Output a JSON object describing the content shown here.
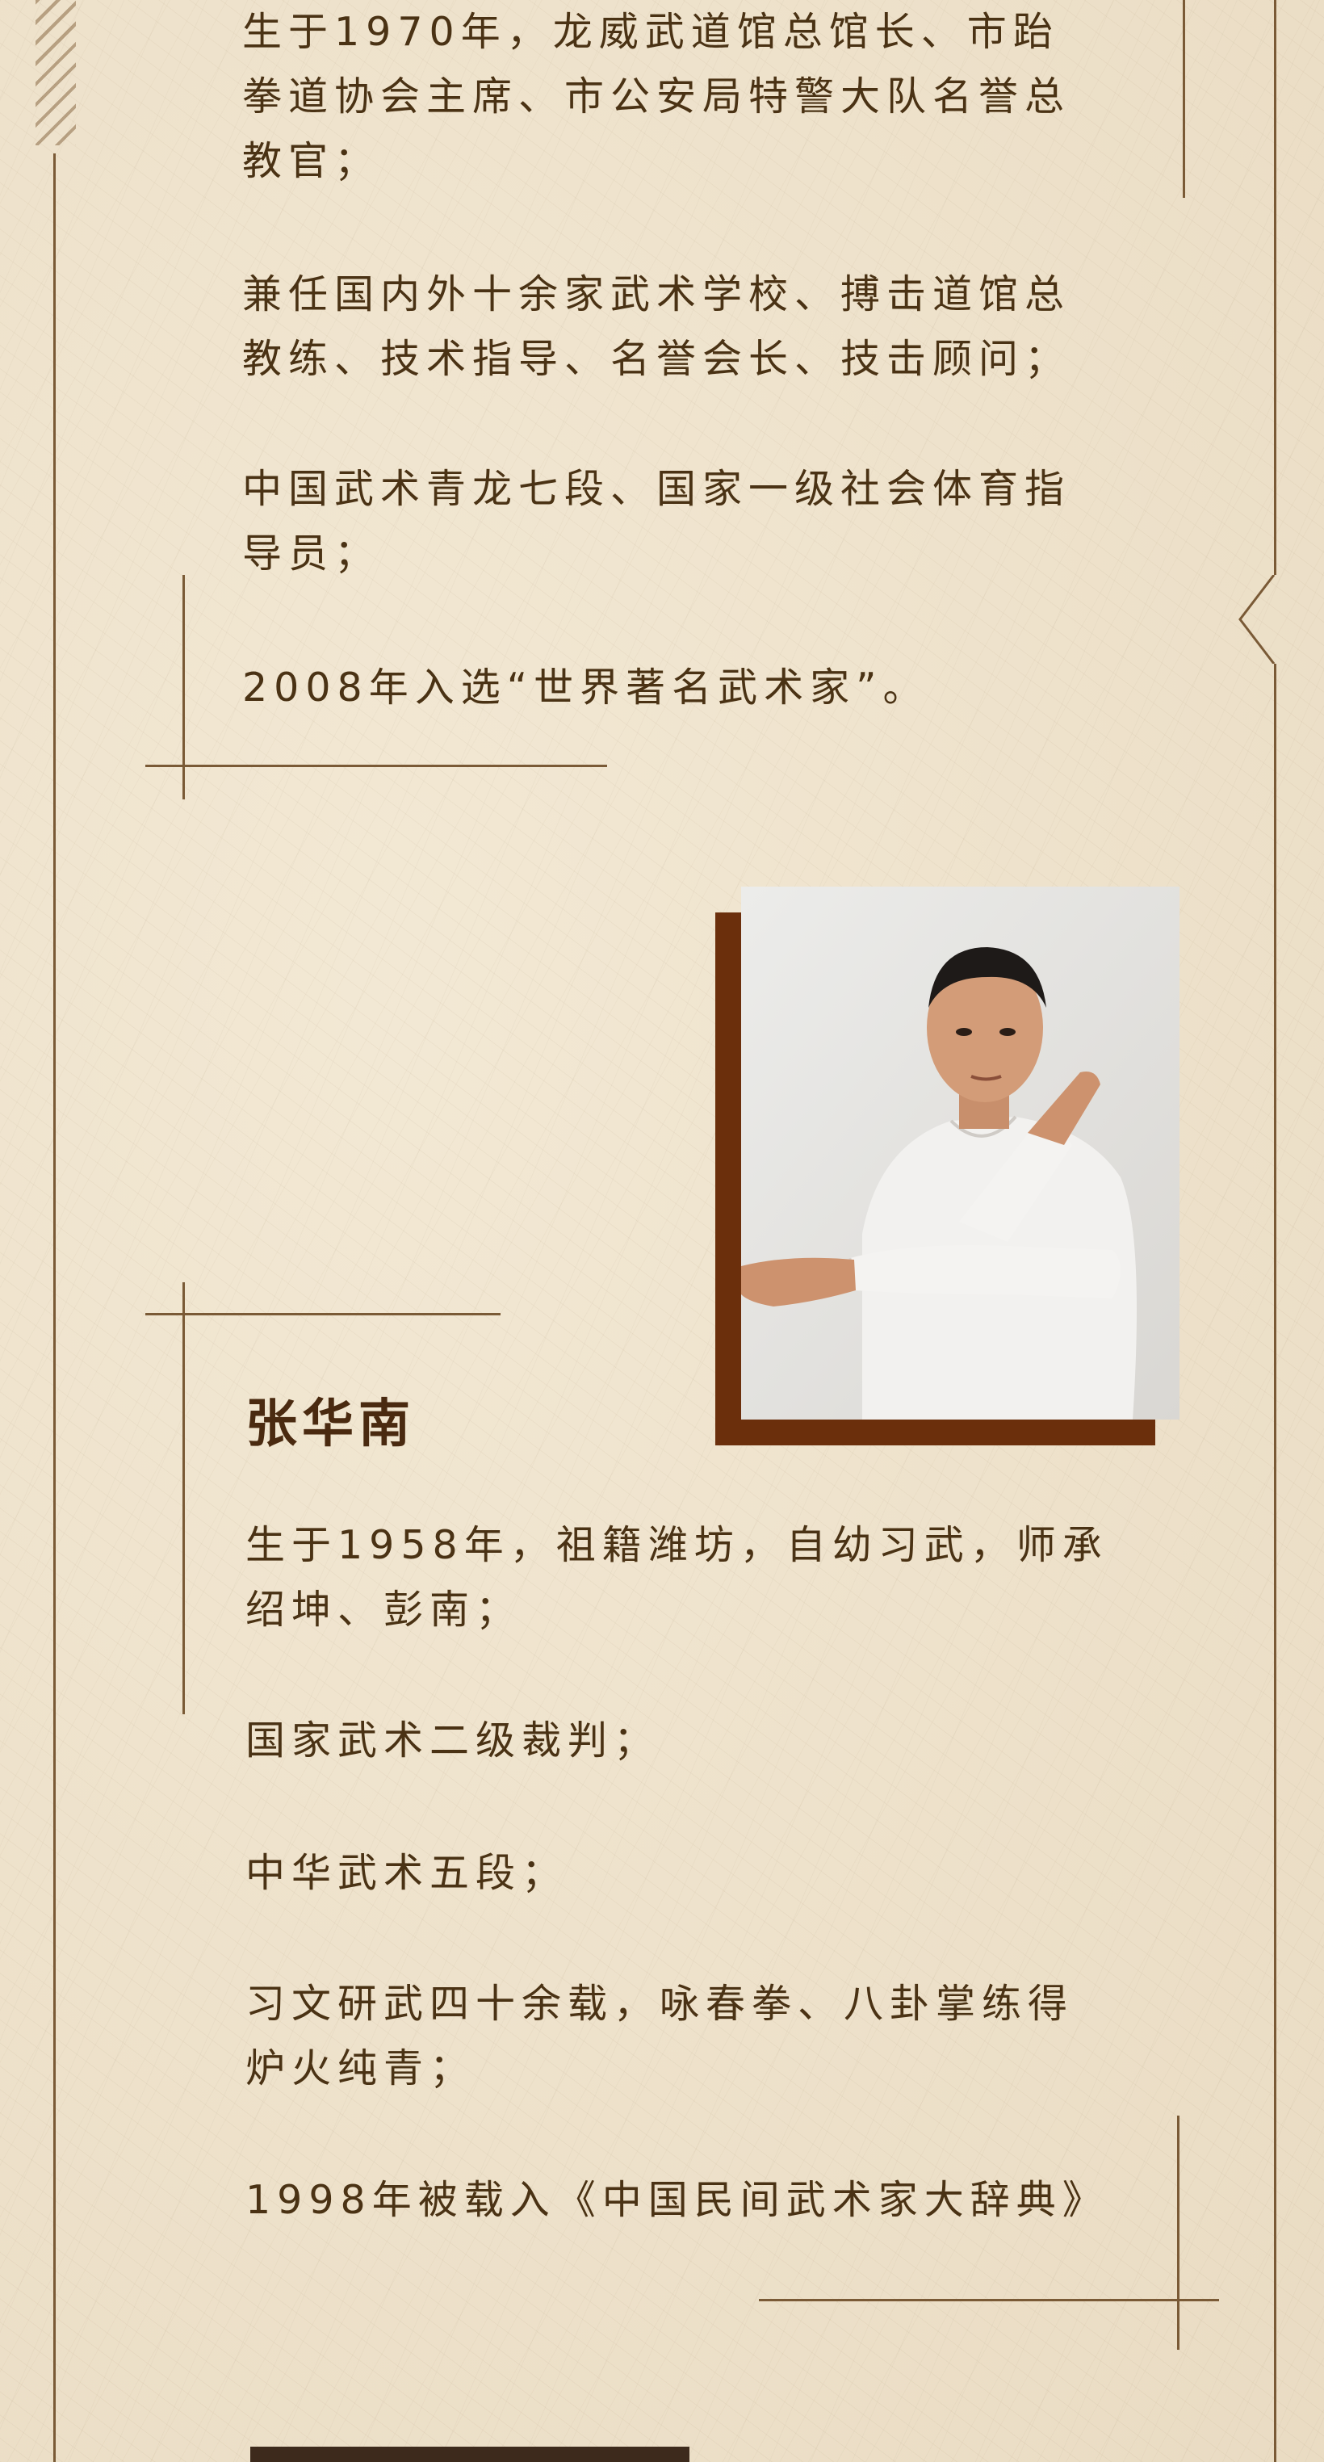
{
  "profile1": {
    "paragraphs": [
      "生于1970年，龙威武道馆总馆长、市跆\n拳道协会主席、市公安局特警大队名誉总\n教官；",
      "兼任国内外十余家武术学校、搏击道馆总\n教练、技术指导、名誉会长、技击顾问；",
      "中国武术青龙七段、国家一级社会体育指\n导员；",
      "2008年入选“世界著名武术家”。"
    ]
  },
  "profile2": {
    "name": "张华南",
    "photo": {
      "icon": "portrait-photo"
    },
    "paragraphs": [
      "生于1958年，祖籍潍坊，自幼习武，师承\n绍坤、彭南；",
      "国家武术二级裁判；",
      "中华武术五段；",
      "习文研武四十余载，咏春拳、八卦掌练得\n炉火纯青；",
      "1998年被载入《中国民间武术家大辞典》"
    ]
  },
  "colors": {
    "background": "#ecdfc8",
    "text": "#4a3214",
    "accent": "#6b2f0c",
    "frame_line": "#7a5a36"
  }
}
